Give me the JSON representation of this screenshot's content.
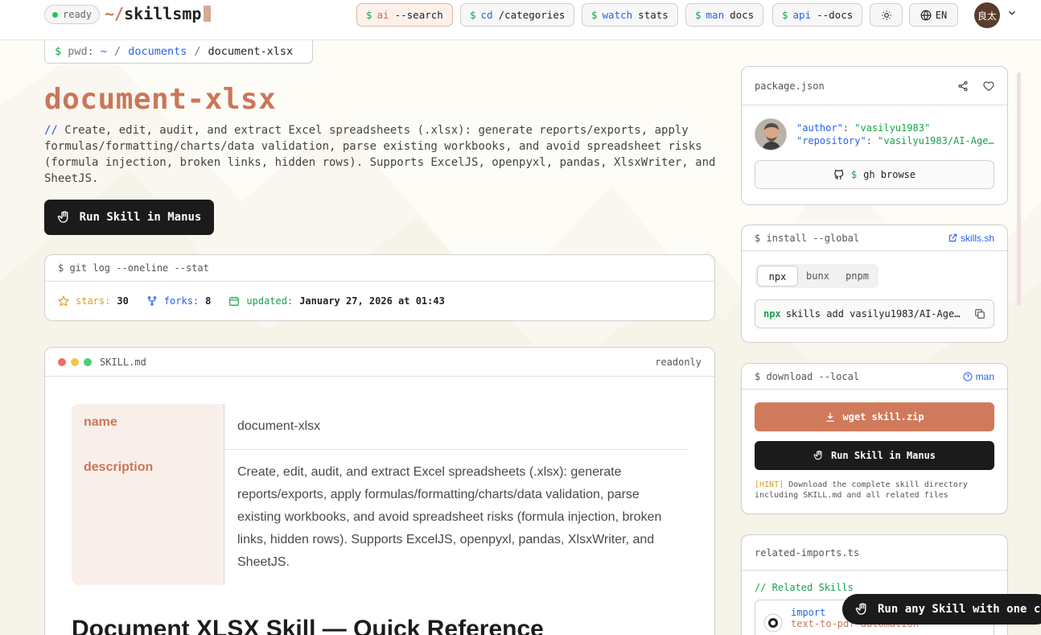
{
  "header": {
    "status": "ready",
    "logo_tilde": "~/",
    "logo_text": "skillsmp",
    "nav": [
      {
        "dollar": "$",
        "cmd": "ai",
        "arg": "--search"
      },
      {
        "dollar": "$",
        "cmd": "cd",
        "arg": "/categories"
      },
      {
        "dollar": "$",
        "cmd": "watch",
        "arg": "stats"
      },
      {
        "dollar": "$",
        "cmd": "man",
        "arg": "docs"
      },
      {
        "dollar": "$",
        "cmd": "api",
        "arg": "--docs"
      }
    ],
    "language": "EN",
    "user_avatar": "良太"
  },
  "breadcrumb": {
    "prefix": "$ pwd:",
    "home": "~",
    "sep": "/",
    "parent": "documents",
    "current": "document-xlsx"
  },
  "page": {
    "title": "document-xlsx",
    "desc_slash": "//",
    "description": "Create, edit, audit, and extract Excel spreadsheets (.xlsx): generate reports/exports, apply formulas/formatting/charts/data validation, parse existing workbooks, and avoid spreadsheet risks (formula injection, broken links, hidden rows). Supports ExcelJS, openpyxl, pandas, XlsxWriter, and SheetJS.",
    "run_button": "Run Skill in Manus"
  },
  "gitlog": {
    "header": "$ git log --oneline --stat",
    "stars_label": "stars:",
    "stars": "30",
    "forks_label": "forks:",
    "forks": "8",
    "updated_label": "updated:",
    "updated": "January 27, 2026 at 01:43"
  },
  "skill_md": {
    "filename": "SKILL.md",
    "mode": "readonly",
    "frontmatter": [
      {
        "key": "name",
        "value": "document-xlsx"
      },
      {
        "key": "description",
        "value": "Create, edit, audit, and extract Excel spreadsheets (.xlsx): generate reports/exports, apply formulas/formatting/charts/data validation, parse existing workbooks, and avoid spreadsheet risks (formula injection, broken links, hidden rows). Supports ExcelJS, openpyxl, pandas, XlsxWriter, and SheetJS."
      }
    ],
    "heading": "Document XLSX Skill — Quick Reference"
  },
  "package": {
    "filename": "package.json",
    "author_key": "\"author\"",
    "author_value": "\"vasilyu1983\"",
    "repo_key": "\"repository\"",
    "repo_value": "\"vasilyu1983/AI-Age…",
    "gh_dollar": "$",
    "gh_label": "gh browse"
  },
  "install": {
    "header": "$ install --global",
    "link": "skills.sh",
    "tabs": [
      "npx",
      "bunx",
      "pnpm"
    ],
    "cmd_prefix": "npx",
    "cmd": "skills add vasilyu1983/AI-Age…"
  },
  "download": {
    "header": "$ download --local",
    "man_link": "man",
    "wget_button": "wget skill.zip",
    "manus_button": "Run Skill in Manus",
    "hint_tag": "[HINT]",
    "hint_text": "Download the complete skill directory including SKILL.md and all related files"
  },
  "related": {
    "filename": "related-imports.ts",
    "comment": "// Related Skills",
    "import_kw": "import",
    "import_name": "text-to-pdf-automation"
  },
  "toast": {
    "text": "Run any Skill with one cl"
  },
  "colors": {
    "accent": "#c9775a",
    "green": "#16a34a",
    "blue": "#2563eb",
    "dark": "#1b1b1b"
  }
}
